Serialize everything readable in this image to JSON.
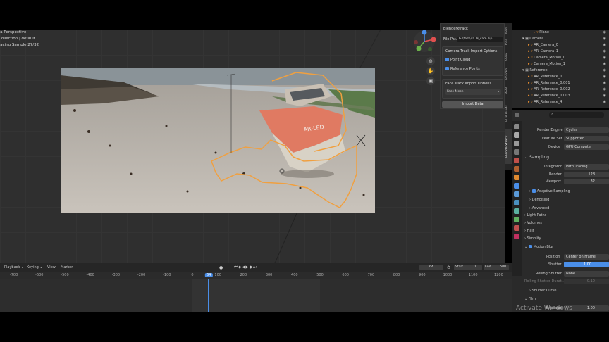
{
  "viewport": {
    "info": [
      "ra Perspective",
      "Collection | default",
      "racing Sample 27/32"
    ],
    "nav_buttons": [
      "zoom-icon",
      "hand-icon",
      "camera-icon"
    ]
  },
  "npanel": {
    "header": "Blenderxtrack",
    "file_path_label": "File Pat..",
    "file_path_value": "G:\\test\\ca..9_cam.zip",
    "camera_section": "Camera Track Import Options",
    "point_cloud": "Point Cloud",
    "reference_points": "Reference Points",
    "face_section": "Face Track Import Options",
    "face_mode": "Face Mesh",
    "import_button": "Import Data"
  },
  "sidebar_tabs": [
    "Item",
    "Tool",
    "View",
    "Rokoko",
    "ARP",
    "FLIP Fluids",
    "Blenderxtrack"
  ],
  "outliner": {
    "rows": [
      {
        "label": "Plane",
        "indent": 3
      },
      {
        "label": "Camera",
        "indent": 1
      },
      {
        "label": "AR_Camera_0",
        "indent": 2
      },
      {
        "label": "AR_Camera_1",
        "indent": 2
      },
      {
        "label": "Camera_Motion_0",
        "indent": 2
      },
      {
        "label": "Camera_Motion_1",
        "indent": 2
      },
      {
        "label": "Reference",
        "indent": 1
      },
      {
        "label": "AR_Reference_0",
        "indent": 2
      },
      {
        "label": "AR_Reference_0.001",
        "indent": 2
      },
      {
        "label": "AR_Reference_0.002",
        "indent": 2
      },
      {
        "label": "AR_Reference_0.003",
        "indent": 2
      },
      {
        "label": "AR_Reference_4",
        "indent": 2
      }
    ]
  },
  "properties": {
    "render_engine_label": "Render Engine",
    "render_engine": "Cycles",
    "feature_set_label": "Feature Set",
    "feature_set": "Supported",
    "device_label": "Device",
    "device": "GPU Compute",
    "sampling": "Sampling",
    "integrator_label": "Integrator",
    "integrator": "Path Tracing",
    "render_label": "Render",
    "render_samples": "128",
    "viewport_label": "Viewport",
    "viewport_samples": "32",
    "adaptive": "Adaptive Sampling",
    "denoising": "Denoising",
    "advanced": "Advanced",
    "light_paths": "Light Paths",
    "volumes": "Volumes",
    "hair": "Hair",
    "simplify": "Simplify",
    "motion_blur": "Motion Blur",
    "position_label": "Position",
    "position": "Center on Frame",
    "shutter_label": "Shutter",
    "shutter": "1.00",
    "rolling_label": "Rolling Shutter",
    "rolling": "None",
    "rolling_dur_label": "Rolling Shutter Durat...",
    "rolling_dur": "0.10",
    "shutter_curve": "Shutter Curve",
    "film": "Film",
    "film_label": "Exposure",
    "film_value": "1.00",
    "watermark": "Activate Windows"
  },
  "timeline": {
    "menus": [
      "Playback",
      "Keying",
      "View",
      "Marker"
    ],
    "current_frame": "64",
    "start_label": "Start",
    "start": "1",
    "end_label": "End",
    "end": "500",
    "ticks": [
      "-700",
      "-600",
      "-500",
      "-400",
      "-300",
      "-200",
      "-100",
      "0",
      "64",
      "100",
      "200",
      "300",
      "400",
      "500",
      "600",
      "700",
      "800",
      "900",
      "1000",
      "1100",
      "1200"
    ]
  }
}
